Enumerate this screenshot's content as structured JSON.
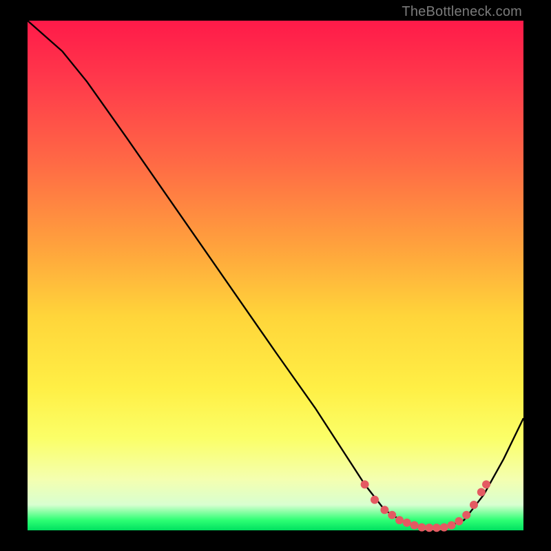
{
  "watermark": "TheBottleneck.com",
  "chart_data": {
    "type": "line",
    "title": "",
    "xlabel": "",
    "ylabel": "",
    "xlim": [
      0,
      100
    ],
    "ylim": [
      0,
      100
    ],
    "background_gradient": {
      "top": "#ff1a49",
      "mid_top": "#ff8a3e",
      "mid": "#ffe23a",
      "mid_bottom": "#f4ffb0",
      "bottom": "#00e060"
    },
    "series": [
      {
        "name": "bottleneck-curve",
        "color": "#000000",
        "points": [
          {
            "x": 0,
            "y": 100
          },
          {
            "x": 7,
            "y": 94
          },
          {
            "x": 12,
            "y": 88
          },
          {
            "x": 20,
            "y": 77
          },
          {
            "x": 30,
            "y": 63
          },
          {
            "x": 40,
            "y": 49
          },
          {
            "x": 50,
            "y": 35
          },
          {
            "x": 58,
            "y": 24
          },
          {
            "x": 64,
            "y": 15
          },
          {
            "x": 68,
            "y": 9
          },
          {
            "x": 72,
            "y": 4
          },
          {
            "x": 76,
            "y": 1.5
          },
          {
            "x": 80,
            "y": 0.5
          },
          {
            "x": 84,
            "y": 0.5
          },
          {
            "x": 88,
            "y": 2
          },
          {
            "x": 92,
            "y": 7
          },
          {
            "x": 96,
            "y": 14
          },
          {
            "x": 100,
            "y": 22
          }
        ]
      },
      {
        "name": "optimum-region-markers",
        "color": "#e45a62",
        "marker": "dot",
        "points": [
          {
            "x": 68,
            "y": 9
          },
          {
            "x": 70,
            "y": 6
          },
          {
            "x": 72,
            "y": 4
          },
          {
            "x": 73.5,
            "y": 3
          },
          {
            "x": 75,
            "y": 2
          },
          {
            "x": 76.5,
            "y": 1.5
          },
          {
            "x": 78,
            "y": 1
          },
          {
            "x": 79.5,
            "y": 0.6
          },
          {
            "x": 81,
            "y": 0.5
          },
          {
            "x": 82.5,
            "y": 0.5
          },
          {
            "x": 84,
            "y": 0.6
          },
          {
            "x": 85.5,
            "y": 1
          },
          {
            "x": 87,
            "y": 1.8
          },
          {
            "x": 88.5,
            "y": 3
          },
          {
            "x": 90,
            "y": 5
          },
          {
            "x": 91.5,
            "y": 7.5
          },
          {
            "x": 92.5,
            "y": 9
          }
        ]
      }
    ]
  }
}
